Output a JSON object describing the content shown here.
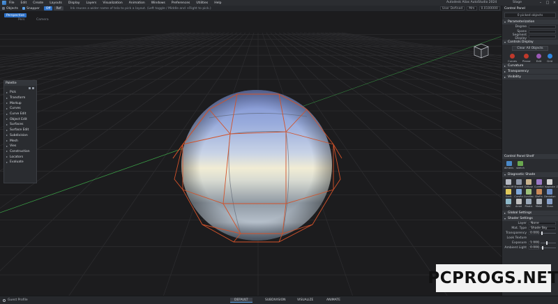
{
  "menubar": {
    "items": [
      "File",
      "Edit",
      "Create",
      "Layouts",
      "Display",
      "Layers",
      "Visualization",
      "Animation",
      "Windows",
      "Preferences",
      "Utilities",
      "Help"
    ],
    "app_title": "Autodesk Alias AutoStudio 2024",
    "app_status": "Stage"
  },
  "toolbar": {
    "objects_label": "Objects",
    "snapper_label": "Snapper",
    "btn1": "Off",
    "btn2": "Ref",
    "hint": "Ink reuses a wider name of tela to pick a layout. (Left toggle / Middle and +Right to pick.)",
    "user_label": "User Defined",
    "field1": "Mm",
    "field2": "0.0100000"
  },
  "viewport": {
    "tab_label": "Perspective",
    "sub1": "Pers",
    "sub2": "Camera"
  },
  "palette": {
    "title": "Palette",
    "items": [
      "Pick",
      "Transform",
      "Markup",
      "Curves",
      "Curve Edit",
      "Object Edit",
      "Surfaces",
      "Surface Edit",
      "Subdivision",
      "Mesh",
      "Vies",
      "Construction",
      "Locators",
      "Evaluate"
    ]
  },
  "panel": {
    "title": "Control Panel",
    "selection": "0 picked objects",
    "sections": {
      "parameterization": "Parameterization",
      "control_display": "Controls Display",
      "curvature": "Curvature",
      "transparency": "Transparency",
      "visibility": "Visibility",
      "shelf": "Control Panel Shelf",
      "diagnostic": "Diagnostic Shade",
      "global": "Global Settings",
      "shader": "Shader Settings"
    },
    "params": [
      {
        "label": "Degree",
        "value": ""
      },
      {
        "label": "Spans",
        "value": ""
      },
      {
        "label": "Segment Display",
        "value": ""
      }
    ],
    "clear_button": "Clear All Objects",
    "snaps": [
      {
        "label": "Curves",
        "color": "#c0392b"
      },
      {
        "label": "Planar",
        "color": "#c0392b"
      },
      {
        "label": "Edit",
        "color": "#9b59b6"
      },
      {
        "label": "Grid",
        "color": "#2e86de"
      }
    ],
    "shelf_items": [
      "dimens",
      "sketch"
    ],
    "materials": [
      "MultiDiff",
      "Shaded",
      "Diffuse",
      "Cureflct",
      "Isophote",
      "Zebra/Vec",
      "Sunlt",
      "CurvRn",
      "CurvSec",
      "DiaFin",
      "Deviation",
      "Draft",
      "NRC",
      "Ambt",
      "Plastic",
      "Metal",
      "Glass",
      "Paint"
    ],
    "shader_props": {
      "layer_label": "Layer",
      "layer_value": "None",
      "mat_label": "Mat. Type",
      "mat_value": "Shade Sky",
      "transparency_label": "Transparency",
      "transparency_value": "0.000",
      "transparency_level": 0.05,
      "look_texture": "Look Texture",
      "exposure_label": "Exposure",
      "exposure_value": "1.000",
      "exposure_level": 0.35,
      "ambient_label": "Ambient Light",
      "ambient_value": "0.000",
      "ambient_level": 0.1
    }
  },
  "status": {
    "left": "Guest Profile",
    "tabs": [
      "DEFAULT",
      "SUBDIVISION",
      "VISUALIZE",
      "ANIMATE"
    ]
  },
  "watermark": "PCPROGS.NET"
}
